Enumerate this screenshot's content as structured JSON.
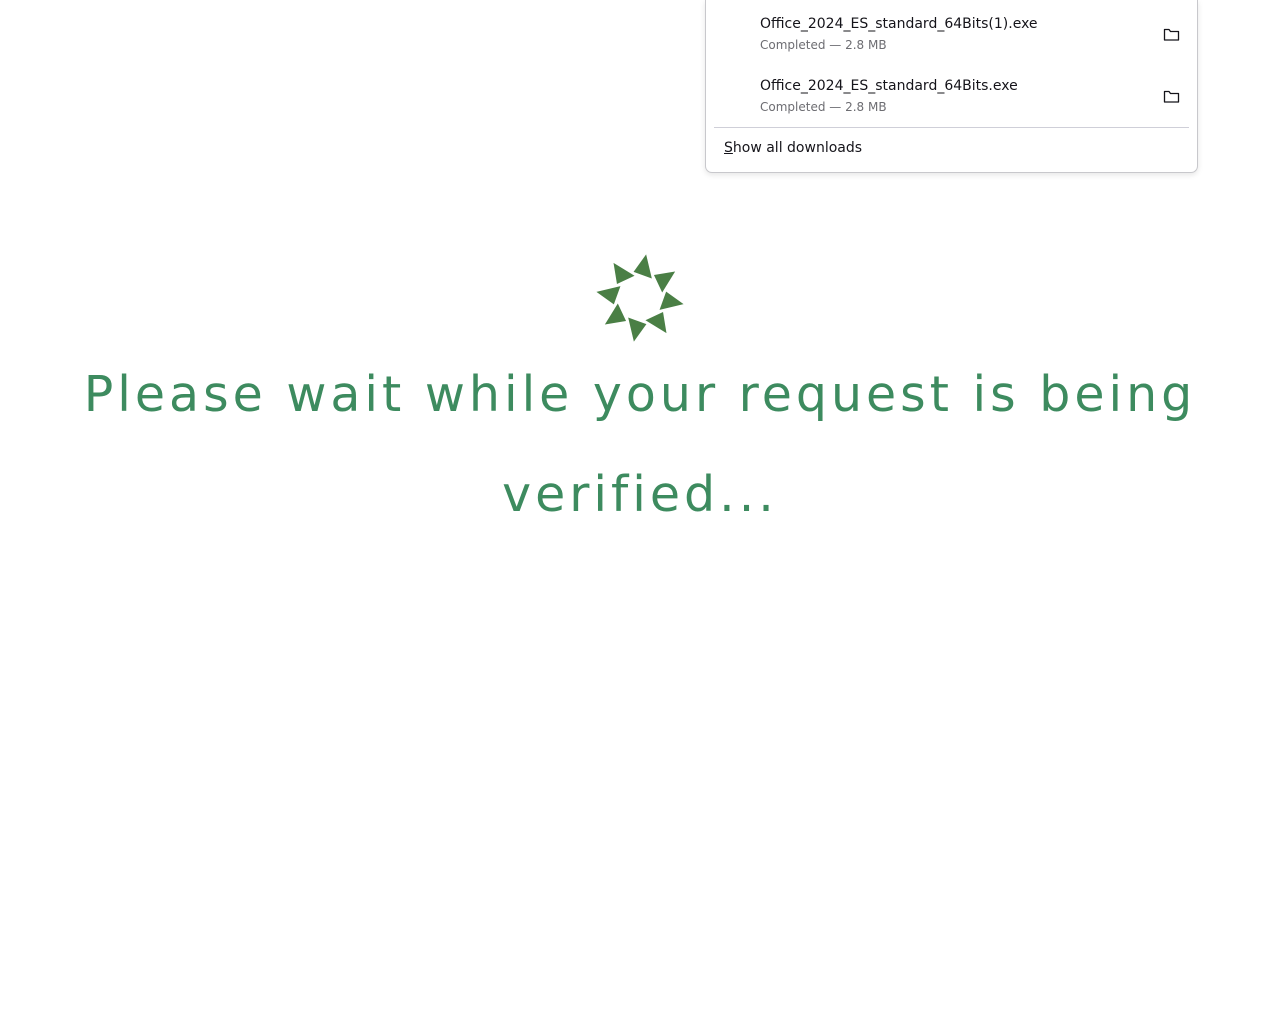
{
  "downloads": {
    "items": [
      {
        "filename": "Office_2024_ES_standard_64Bits(1).exe",
        "status": "Completed — 2.8 MB",
        "action_icon": "folder-icon"
      },
      {
        "filename": "Office_2024_ES_standard_64Bits.exe",
        "status": "Completed — 2.8 MB",
        "action_icon": "folder-icon"
      }
    ],
    "show_all_accel": "S",
    "show_all_rest": "how all downloads"
  },
  "main": {
    "spinner_icon": "spinner-icon",
    "message": "Please wait while your request is being verified..."
  },
  "colors": {
    "spinner": "#4a7f45",
    "message": "#3d8b5f",
    "panel_border": "#c8c8cc"
  }
}
